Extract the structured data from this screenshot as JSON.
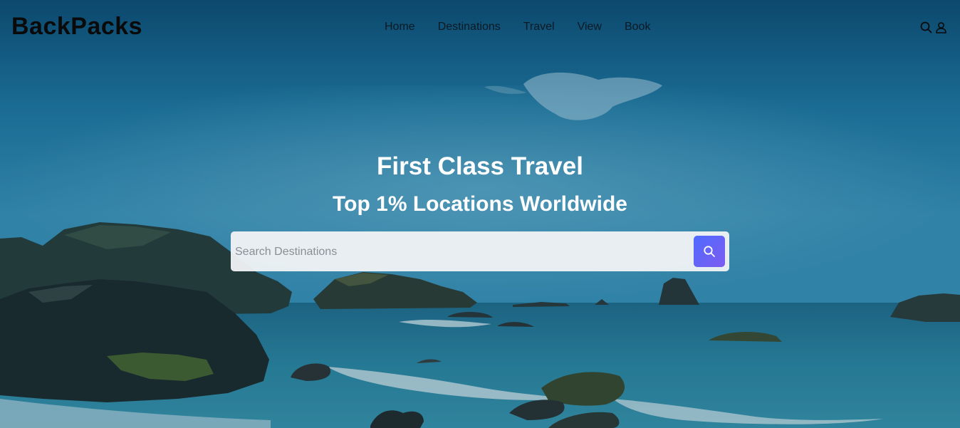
{
  "brand": {
    "name": "BackPacks"
  },
  "nav": {
    "items": [
      "Home",
      "Destinations",
      "Travel",
      "View",
      "Book"
    ]
  },
  "header_icons": [
    "search-icon",
    "user-icon"
  ],
  "hero": {
    "title": "First Class Travel",
    "subtitle": "Top 1% Locations Worldwide",
    "search": {
      "placeholder": "Search Destinations",
      "value": ""
    }
  },
  "colors": {
    "search_button": "#5d63f5",
    "text_light": "#ffffff",
    "text_dark": "#0a0a0a"
  }
}
